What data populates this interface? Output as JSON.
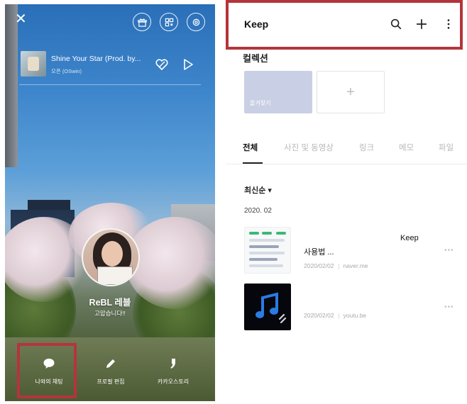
{
  "profile": {
    "music": {
      "title": "Shine Your Star (Prod. by...",
      "artist": "오픈 (OSwin)"
    },
    "name": "ReBL 레블",
    "status_message": "고맙습니다!!",
    "actions": [
      {
        "label": "나와의 채팅",
        "icon": "chat-bubble-icon"
      },
      {
        "label": "프로필 편집",
        "icon": "pencil-icon"
      },
      {
        "label": "카카오스토리",
        "icon": "kakaostory-icon"
      }
    ]
  },
  "keep": {
    "title": "Keep",
    "collection_title": "컬렉션",
    "collection_card_label": "즐겨찾기",
    "tabs": [
      "전체",
      "사진 및 동영상",
      "링크",
      "메모",
      "파일"
    ],
    "sort_label": "최신순 ▾",
    "month_label": "2020. 02",
    "items": [
      {
        "title_right": "Keep",
        "title": "사용법 ...",
        "date": "2020/02/02",
        "source": "naver.me",
        "more": "•••"
      },
      {
        "title": "",
        "date": "2020/02/02",
        "source": "youtu.be",
        "more": "•••"
      }
    ]
  },
  "colors": {
    "highlight": "#b5343b",
    "collection_card": "#c9cfe4",
    "music_thumb_bg": "#05070d"
  }
}
